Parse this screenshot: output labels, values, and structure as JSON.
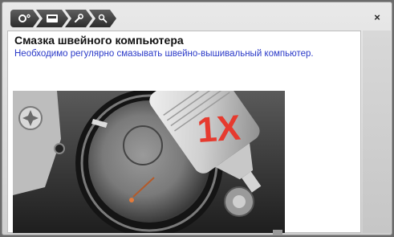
{
  "window": {
    "close_glyph": "×"
  },
  "breadcrumbs": [
    {
      "icon": "settings-toggle-icon"
    },
    {
      "icon": "screen-icon"
    },
    {
      "icon": "wrench-icon"
    },
    {
      "icon": "search-icon"
    }
  ],
  "content": {
    "title": "Смазка швейного компьютера",
    "description": "Необходимо регулярно смазывать швейно-вышивальный компьютер.",
    "image": {
      "overlay_text": "1X",
      "overlay_color": "#e63a2e"
    }
  },
  "colors": {
    "description_text": "#2a39c8",
    "breadcrumb_bg": "#3a3a3a"
  }
}
